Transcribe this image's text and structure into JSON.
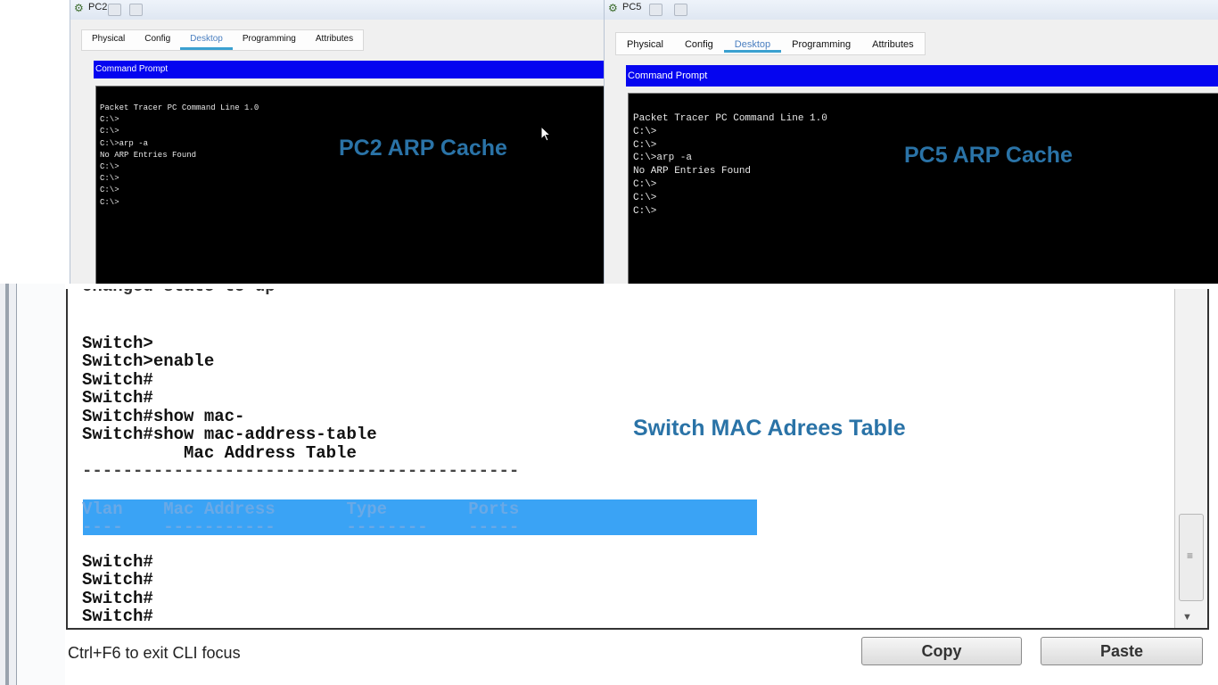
{
  "pc2": {
    "title": "PC2",
    "tabs": [
      "Physical",
      "Config",
      "Desktop",
      "Programming",
      "Attributes"
    ],
    "active_tab": "Desktop",
    "cmd_header": "Command Prompt",
    "console_lines": [
      "Packet Tracer PC Command Line 1.0",
      "C:\\>",
      "C:\\>",
      "C:\\>arp -a",
      "No ARP Entries Found",
      "C:\\>",
      "C:\\>",
      "C:\\>",
      "C:\\>"
    ],
    "overlay_label": "PC2 ARP Cache"
  },
  "pc5": {
    "title": "PC5",
    "tabs": [
      "Physical",
      "Config",
      "Desktop",
      "Programming",
      "Attributes"
    ],
    "active_tab": "Desktop",
    "cmd_header": "Command Prompt",
    "console_lines": [
      "Packet Tracer PC Command Line 1.0",
      "C:\\>",
      "C:\\>",
      "C:\\>arp -a",
      "No ARP Entries Found",
      "C:\\>",
      "C:\\>",
      "C:\\>"
    ],
    "overlay_label": "PC5 ARP Cache"
  },
  "switch": {
    "overlay_label": "Switch MAC Adrees Table",
    "cli_lines": [
      "Switch>",
      "Switch>enable",
      "Switch#",
      "Switch#",
      "Switch#show mac-",
      "Switch#show mac-address-table",
      "          Mac Address Table",
      "-------------------------------------------"
    ],
    "table_header": "Vlan    Mac Address       Type        Ports",
    "table_underline": "----    -----------       --------    -----",
    "after_lines": [
      "Switch#",
      "Switch#",
      "Switch#",
      "Switch#"
    ],
    "status_text": "Ctrl+F6 to exit CLI focus",
    "copy_label": "Copy",
    "paste_label": "Paste"
  }
}
